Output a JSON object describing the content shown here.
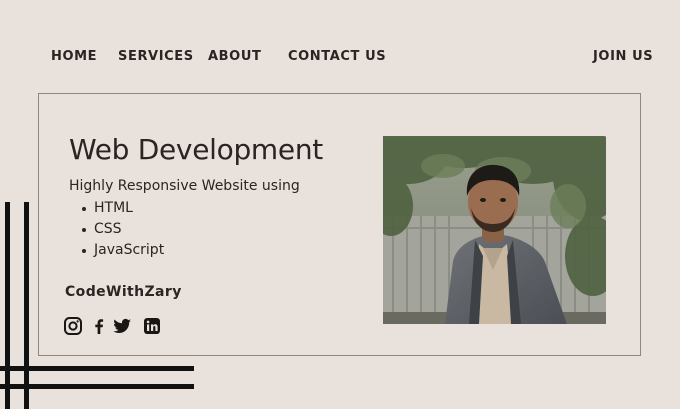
{
  "nav": {
    "home": "HOME",
    "services": "SERVICES",
    "about": "ABOUT",
    "contact": "CONTACT US",
    "join": "JOIN US"
  },
  "hero": {
    "title": "Web Development",
    "subtitle": "Highly Responsive Website using",
    "technologies": [
      "HTML",
      "CSS",
      "JavaScript"
    ],
    "brand": "CodeWithZary"
  },
  "social_icons": [
    "instagram-icon",
    "facebook-icon",
    "twitter-icon",
    "linkedin-icon"
  ],
  "colors": {
    "background": "#e9e1dc",
    "text": "#2a2522",
    "border": "#8e8680",
    "accent_lines": "#111111"
  }
}
